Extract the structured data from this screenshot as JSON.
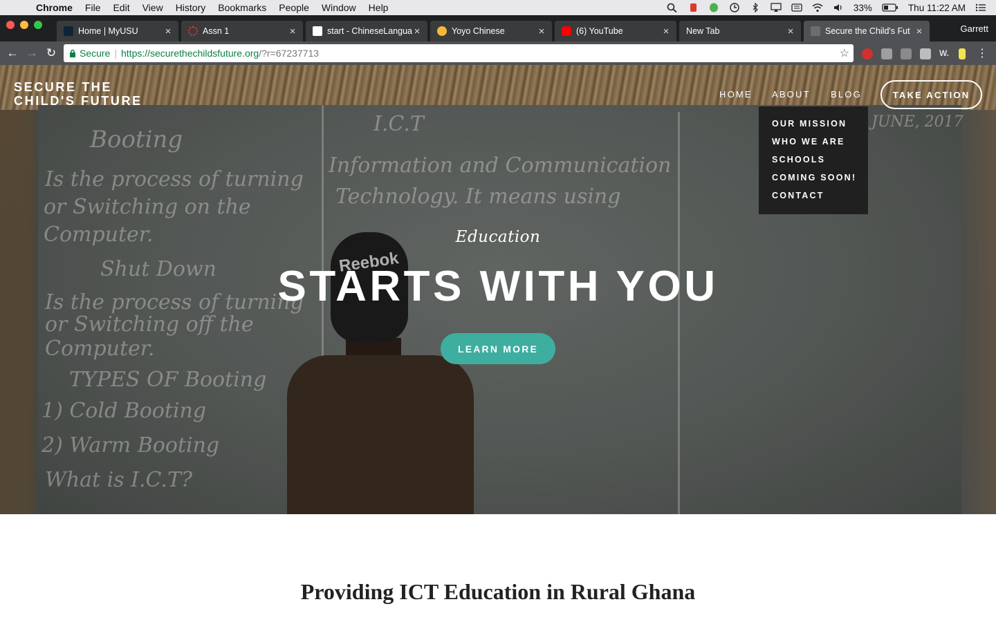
{
  "menubar": {
    "app": "Chrome",
    "items": [
      "File",
      "Edit",
      "View",
      "History",
      "Bookmarks",
      "People",
      "Window",
      "Help"
    ],
    "battery": "33%",
    "clock": "Thu 11:22 AM"
  },
  "tabs": [
    {
      "title": "Home | MyUSU",
      "favicon_color": "#0f2439"
    },
    {
      "title": "Assn 1",
      "favicon_color": "#e53935"
    },
    {
      "title": "start - ChineseLangua",
      "favicon_color": "#ffffff"
    },
    {
      "title": "Yoyo Chinese",
      "favicon_color": "#f5b93a"
    },
    {
      "title": "(6) YouTube",
      "favicon_color": "#ff0000"
    },
    {
      "title": "New Tab",
      "favicon_color": ""
    },
    {
      "title": "Secure the Child's Fut",
      "favicon_color": "#6d6d6d"
    }
  ],
  "profile": "Garrett",
  "address": {
    "secure_label": "Secure",
    "url": "https://securethechildsfuture.org",
    "query": "/?r=67237713"
  },
  "site": {
    "logo_line1": "SECURE THE",
    "logo_line2": "CHILD'S FUTURE",
    "nav": {
      "home": "HOME",
      "about": "ABOUT",
      "blog": "BLOG"
    },
    "cta": "TAKE ACTION",
    "about_menu": [
      "OUR MISSION",
      "WHO WE ARE",
      "SCHOOLS",
      "COMING SOON!",
      "CONTACT"
    ],
    "hero": {
      "eyebrow": "Education",
      "headline": "STARTS WITH YOU",
      "button": "LEARN MORE",
      "button_color": "#3eaea1"
    },
    "section_title": "Providing ICT Education in Rural Ghana"
  },
  "colors": {
    "accent": "#3eaea1",
    "dropdown_bg": "#202020"
  }
}
